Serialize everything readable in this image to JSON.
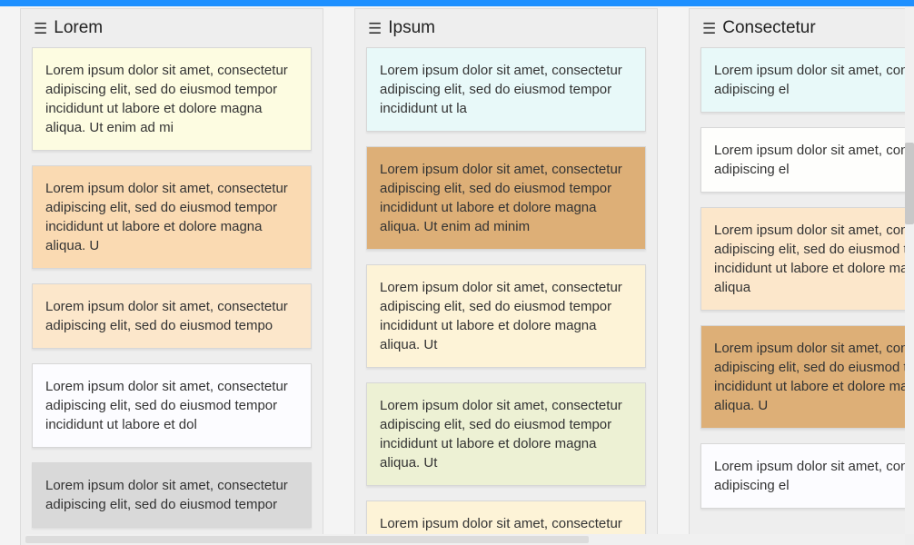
{
  "colors": {
    "accent_bar": "#1e90ff",
    "card_tones": {
      "cream": "#fdfce1",
      "peach": "#fadab2",
      "light_peach": "#fce7cb",
      "near_white": "#fcfcff",
      "grey": "#d9d9d9",
      "pale_cyan": "#e8f9f9",
      "tan": "#ddaf77",
      "cream2": "#fdf3d7",
      "sage": "#edf1d4",
      "off_white": "#fefefc"
    }
  },
  "columns": [
    {
      "title": "Lorem",
      "cards": [
        {
          "color": "cream",
          "text": "Lorem ipsum dolor sit amet, consectetur adipiscing elit, sed do eiusmod tempor incididunt ut labore et dolore magna aliqua. Ut enim ad mi"
        },
        {
          "color": "peach",
          "text": "Lorem ipsum dolor sit amet, consectetur adipiscing elit, sed do eiusmod tempor incididunt ut labore et dolore magna aliqua. U"
        },
        {
          "color": "light_peach",
          "text": "Lorem ipsum dolor sit amet, consectetur adipiscing elit, sed do eiusmod tempo"
        },
        {
          "color": "near_white",
          "text": "Lorem ipsum dolor sit amet, consectetur adipiscing elit, sed do eiusmod tempor incididunt ut labore et dol"
        },
        {
          "color": "grey",
          "text": "Lorem ipsum dolor sit amet, consectetur adipiscing elit, sed do eiusmod tempor"
        }
      ]
    },
    {
      "title": "Ipsum",
      "cards": [
        {
          "color": "pale_cyan",
          "text": "Lorem ipsum dolor sit amet, consectetur adipiscing elit, sed do eiusmod tempor incididunt ut la"
        },
        {
          "color": "tan",
          "text": "Lorem ipsum dolor sit amet, consectetur adipiscing elit, sed do eiusmod tempor incididunt ut labore et dolore magna aliqua. Ut enim ad minim"
        },
        {
          "color": "cream2",
          "text": "Lorem ipsum dolor sit amet, consectetur adipiscing elit, sed do eiusmod tempor incididunt ut labore et dolore magna aliqua. Ut"
        },
        {
          "color": "sage",
          "text": "Lorem ipsum dolor sit amet, consectetur adipiscing elit, sed do eiusmod tempor incididunt ut labore et dolore magna aliqua. Ut"
        },
        {
          "color": "cream2",
          "text": "Lorem ipsum dolor sit amet, consectetur"
        }
      ]
    },
    {
      "title": "Consectetur",
      "cards": [
        {
          "color": "pale_cyan",
          "text": "Lorem ipsum dolor sit amet, consectetur adipiscing el"
        },
        {
          "color": "off_white",
          "text": "Lorem ipsum dolor sit amet, consectetur adipiscing el"
        },
        {
          "color": "light_peach",
          "text": "Lorem ipsum dolor sit amet, consectetur adipiscing elit, sed do eiusmod tempor incididunt ut labore et dolore magna aliqua"
        },
        {
          "color": "tan",
          "text": "Lorem ipsum dolor sit amet, consectetur adipiscing elit, sed do eiusmod tempor incididunt ut labore et dolore magna aliqua. U"
        },
        {
          "color": "near_white",
          "text": "Lorem ipsum dolor sit amet, consectetur adipiscing el"
        }
      ]
    }
  ]
}
